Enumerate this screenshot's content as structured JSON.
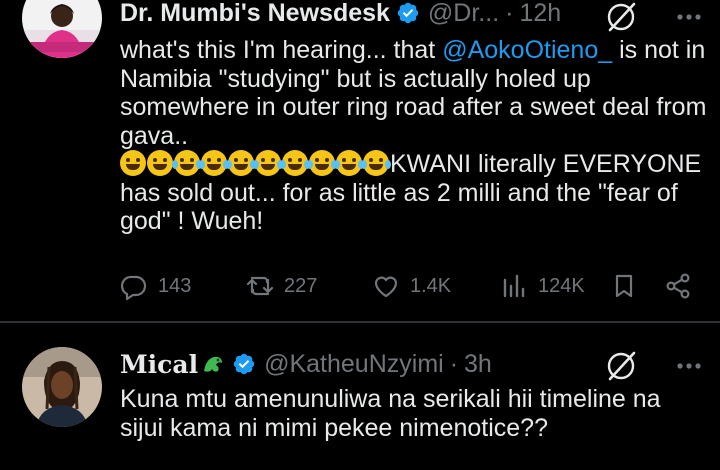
{
  "tweets": [
    {
      "name": "Dr. Mumbi's Newsdesk",
      "handle": "@Dr...",
      "time": "12h",
      "line1_a": "what's this I'm hearing... that ",
      "mention": "@AokoOtieno_",
      "line1_b": " is not in Namibia \"studying\" but is actually holed up somewhere in outer ring road after a sweet deal from gava..",
      "emoji_count": 10,
      "line2": "KWANI literally EVERYONE has sold out... for as little as 2 milli and the \"fear of god\" ! Wueh!",
      "actions": {
        "replies": "143",
        "reposts": "227",
        "likes": "1.4K",
        "views": "124K"
      }
    },
    {
      "name": "Mical",
      "handle": "@KatheuNzyimi",
      "time": "3h",
      "text": "Kuna mtu amenunuliwa na serikali hii timeline na sijui kama ni mimi pekee nimenotice??"
    }
  ],
  "colors": {
    "background": "#000000",
    "text": "#e7e9ea",
    "muted": "#71767b",
    "accent": "#1d9bf0",
    "divider": "#2f3336"
  },
  "icons": [
    "verified-badge-icon",
    "grok-icon",
    "more-icon",
    "reply-icon",
    "repost-icon",
    "like-icon",
    "views-icon",
    "bookmark-icon",
    "share-icon",
    "dragon-emoji-icon"
  ]
}
